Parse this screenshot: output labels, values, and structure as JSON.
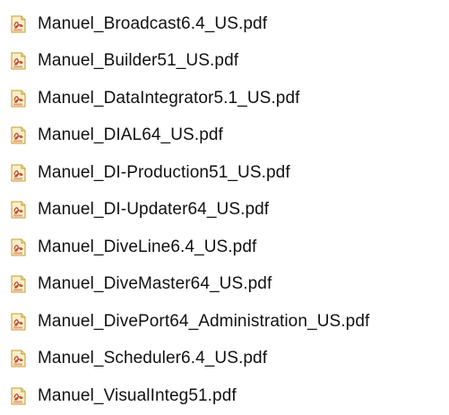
{
  "files": [
    {
      "name": "Manuel_Broadcast6.4_US.pdf",
      "icon": "pdf-file-icon"
    },
    {
      "name": "Manuel_Builder51_US.pdf",
      "icon": "pdf-file-icon"
    },
    {
      "name": "Manuel_DataIntegrator5.1_US.pdf",
      "icon": "pdf-file-icon"
    },
    {
      "name": "Manuel_DIAL64_US.pdf",
      "icon": "pdf-file-icon"
    },
    {
      "name": "Manuel_DI-Production51_US.pdf",
      "icon": "pdf-file-icon"
    },
    {
      "name": "Manuel_DI-Updater64_US.pdf",
      "icon": "pdf-file-icon"
    },
    {
      "name": "Manuel_DiveLine6.4_US.pdf",
      "icon": "pdf-file-icon"
    },
    {
      "name": "Manuel_DiveMaster64_US.pdf",
      "icon": "pdf-file-icon"
    },
    {
      "name": "Manuel_DivePort64_Administration_US.pdf",
      "icon": "pdf-file-icon"
    },
    {
      "name": "Manuel_Scheduler6.4_US.pdf",
      "icon": "pdf-file-icon"
    },
    {
      "name": "Manuel_VisualInteg51.pdf",
      "icon": "pdf-file-icon"
    }
  ],
  "colors": {
    "icon_body": "#f7efc8",
    "icon_border": "#c79a2e",
    "icon_symbol": "#c0392b",
    "text": "#111111"
  }
}
